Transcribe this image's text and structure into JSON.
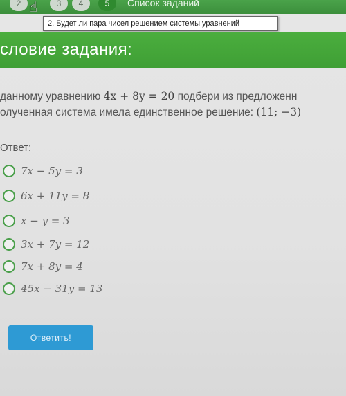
{
  "nav": {
    "numbers": [
      "2",
      "3",
      "4",
      "5"
    ],
    "active_index": 3,
    "task_list_label": "Список заданий"
  },
  "tooltip": "2. Будет ли пара чисел решением системы уравнений",
  "header": {
    "title": "словие задания:"
  },
  "task": {
    "line1_prefix": "данному уравнению ",
    "line1_math1": "4x + 8y = 20",
    "line1_suffix": " подбери из предложенн",
    "line2_prefix": "олученная система имела единственное решение: ",
    "line2_math": "(11; −3)"
  },
  "answer_label": "Ответ:",
  "options": [
    "7x − 5y = 3",
    "6x + 11y = 8",
    "x − y = 3",
    "3x + 7y = 12",
    "7x + 8y = 4",
    "45x − 31y = 13"
  ],
  "submit_label": "Ответить!",
  "colors": {
    "header_green": "#43a639",
    "radio_green": "#4a9f4a",
    "button_blue": "#2e9ad4"
  }
}
